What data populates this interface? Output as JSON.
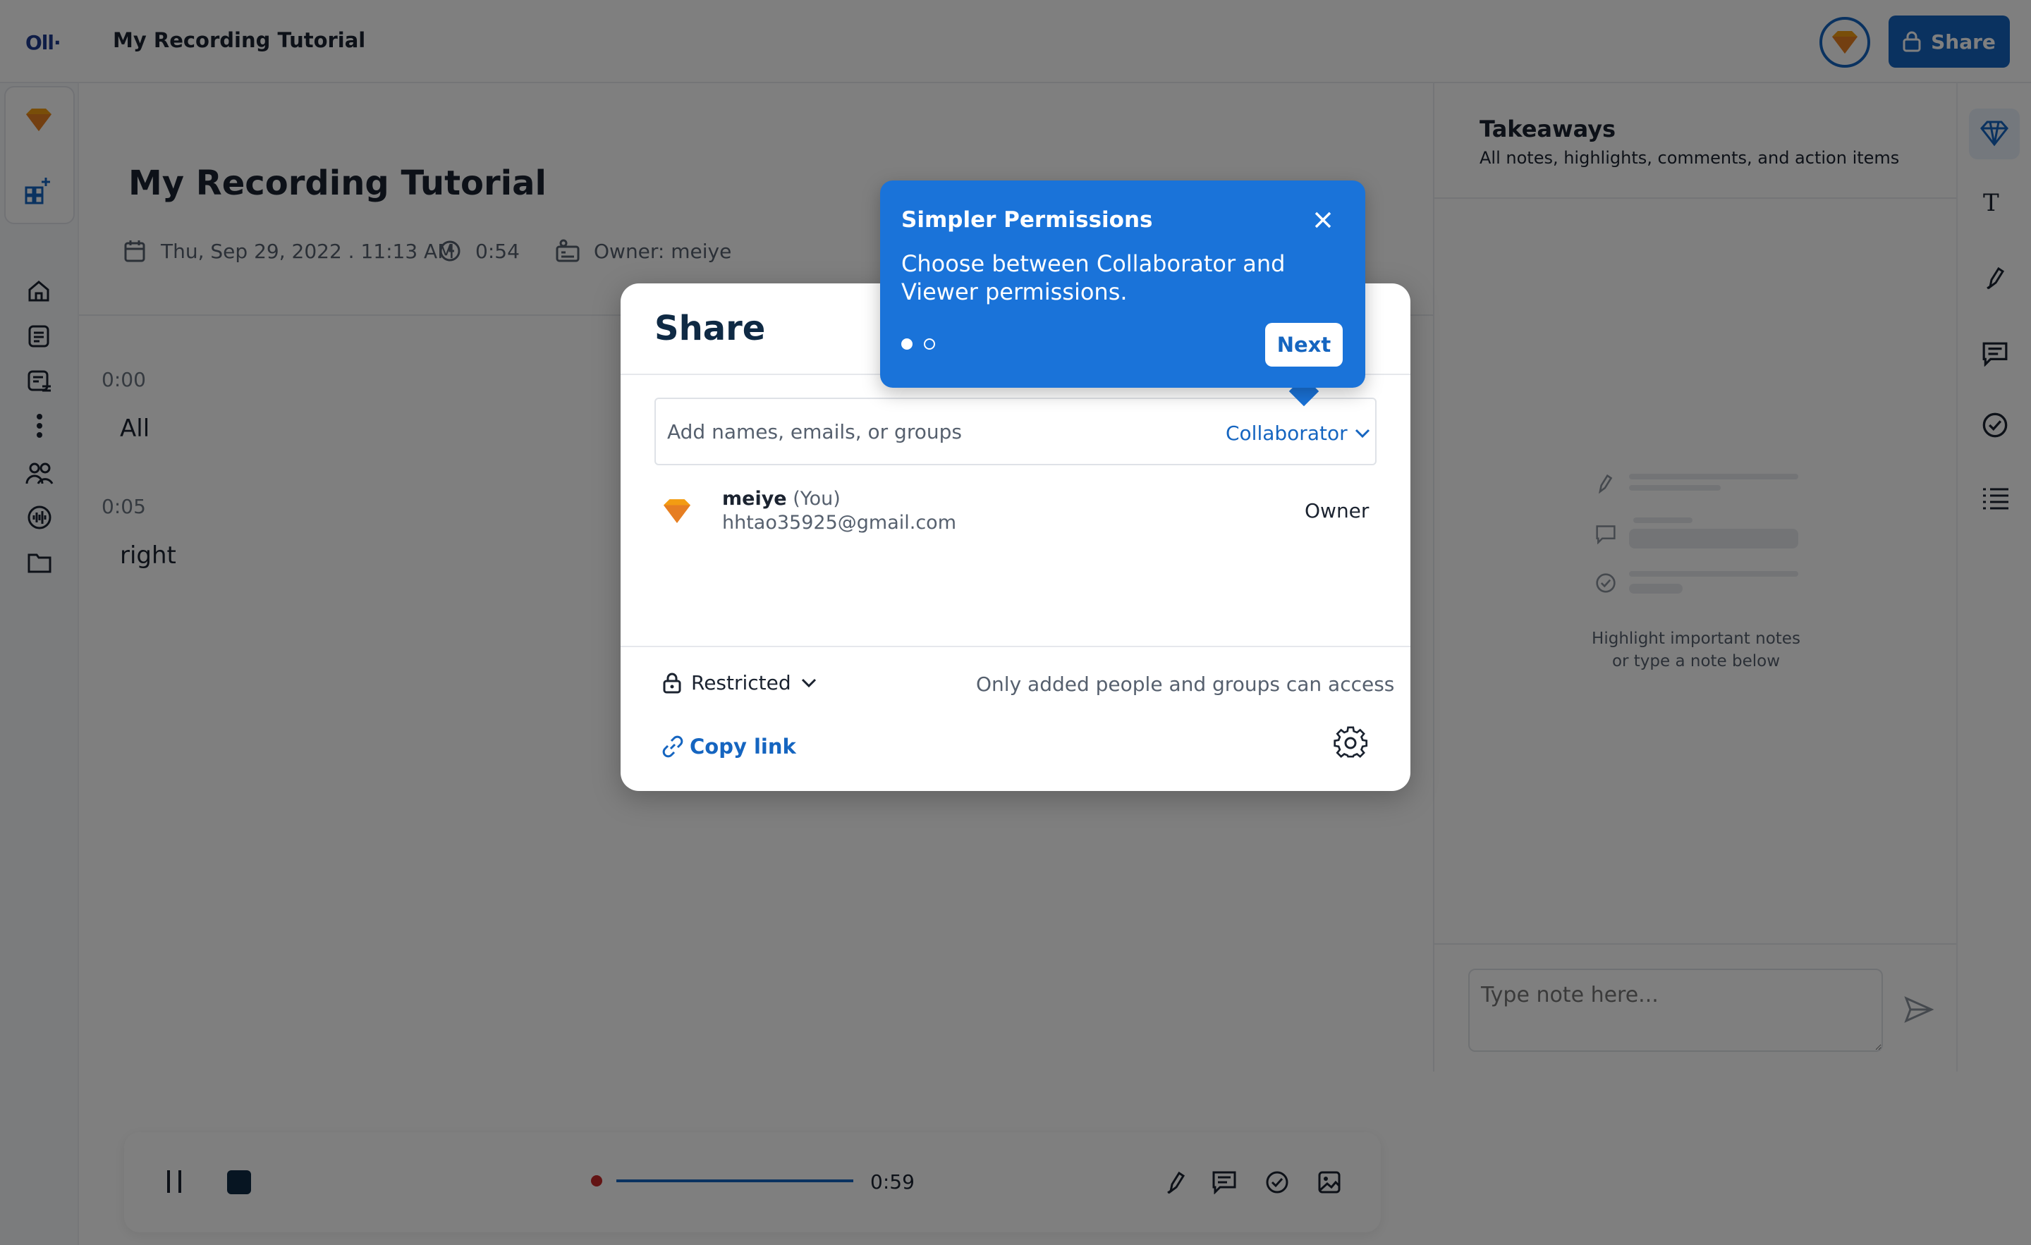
{
  "header": {
    "logo_text": "Oll·",
    "doc_title": "My Recording Tutorial",
    "share_label": "Share",
    "avatar_icon": "gem-avatar-icon"
  },
  "leftnav": {
    "items": [
      "gem-icon",
      "add-app-icon",
      "home-icon",
      "notes-icon",
      "list-icon",
      "more-icon",
      "people-icon",
      "audio-icon",
      "folder-icon"
    ]
  },
  "main": {
    "title": "My Recording Tutorial",
    "date": "Thu, Sep 29, 2022 . 11:13 AM",
    "duration": "0:54",
    "owner": "Owner: meiye",
    "transcript": [
      {
        "time": "0:00",
        "text": "All"
      },
      {
        "time": "0:05",
        "text": "right"
      }
    ]
  },
  "player": {
    "timecode": "0:59"
  },
  "takeaways": {
    "title": "Takeaways",
    "subtitle": "All notes, highlights, comments, and action items",
    "empty_line1": "Highlight important notes",
    "empty_line2": "or type a note below",
    "note_placeholder": "Type note here..."
  },
  "share_dialog": {
    "title": "Share",
    "add_placeholder": "Add names, emails, or groups",
    "role_select": "Collaborator",
    "people": [
      {
        "name": "meiye",
        "you_tag": "(You)",
        "email": "hhtao35925@gmail.com",
        "role": "Owner"
      }
    ],
    "access_level": "Restricted",
    "access_note": "Only added people and groups can access",
    "copy_link": "Copy link"
  },
  "tooltip": {
    "title": "Simpler Permissions",
    "body": "Choose between Collaborator and Viewer permissions.",
    "next_label": "Next",
    "step_current": 1,
    "step_total": 2
  },
  "colors": {
    "accent": "#1565c0",
    "tooltip": "#1a73d9",
    "avatar_orange": "#f39c12"
  }
}
